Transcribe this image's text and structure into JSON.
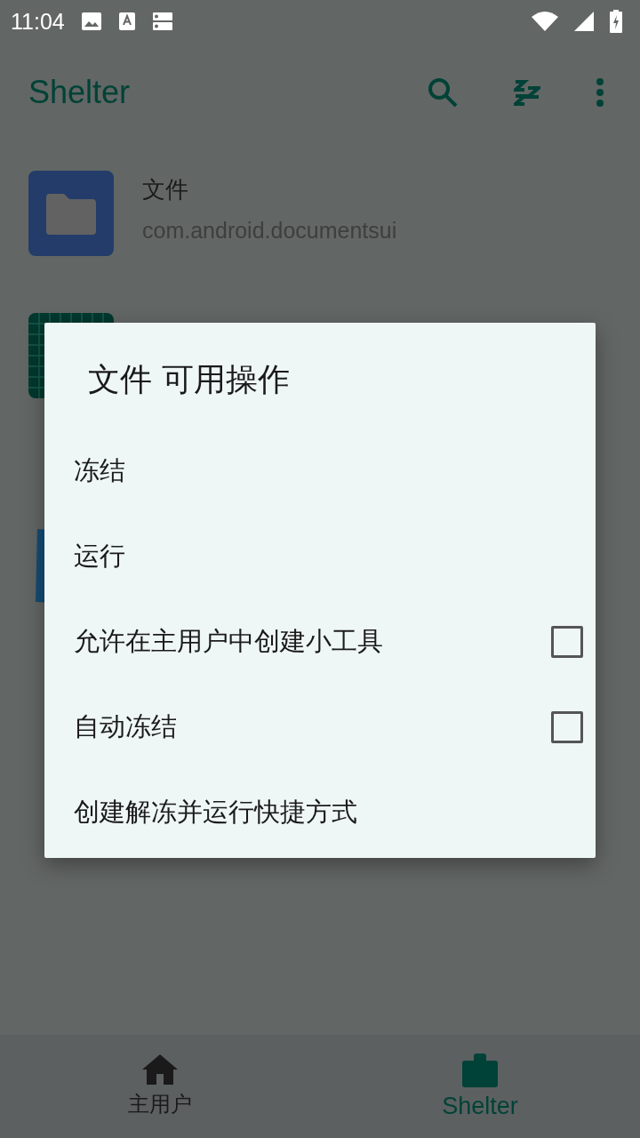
{
  "status_bar": {
    "time": "11:04"
  },
  "app_bar": {
    "title": "Shelter"
  },
  "apps": [
    {
      "name": "文件",
      "package": "com.android.documentsui"
    }
  ],
  "dialog": {
    "title": "文件 可用操作",
    "items": [
      {
        "label": "冻结",
        "kind": "action"
      },
      {
        "label": "运行",
        "kind": "action"
      },
      {
        "label": "允许在主用户中创建小工具",
        "kind": "checkbox",
        "checked": false
      },
      {
        "label": "自动冻结",
        "kind": "checkbox",
        "checked": false
      },
      {
        "label": "创建解冻并运行快捷方式",
        "kind": "action"
      }
    ]
  },
  "bottom_nav": [
    {
      "label": "主用户",
      "selected": false
    },
    {
      "label": "Shelter",
      "selected": true
    }
  ]
}
